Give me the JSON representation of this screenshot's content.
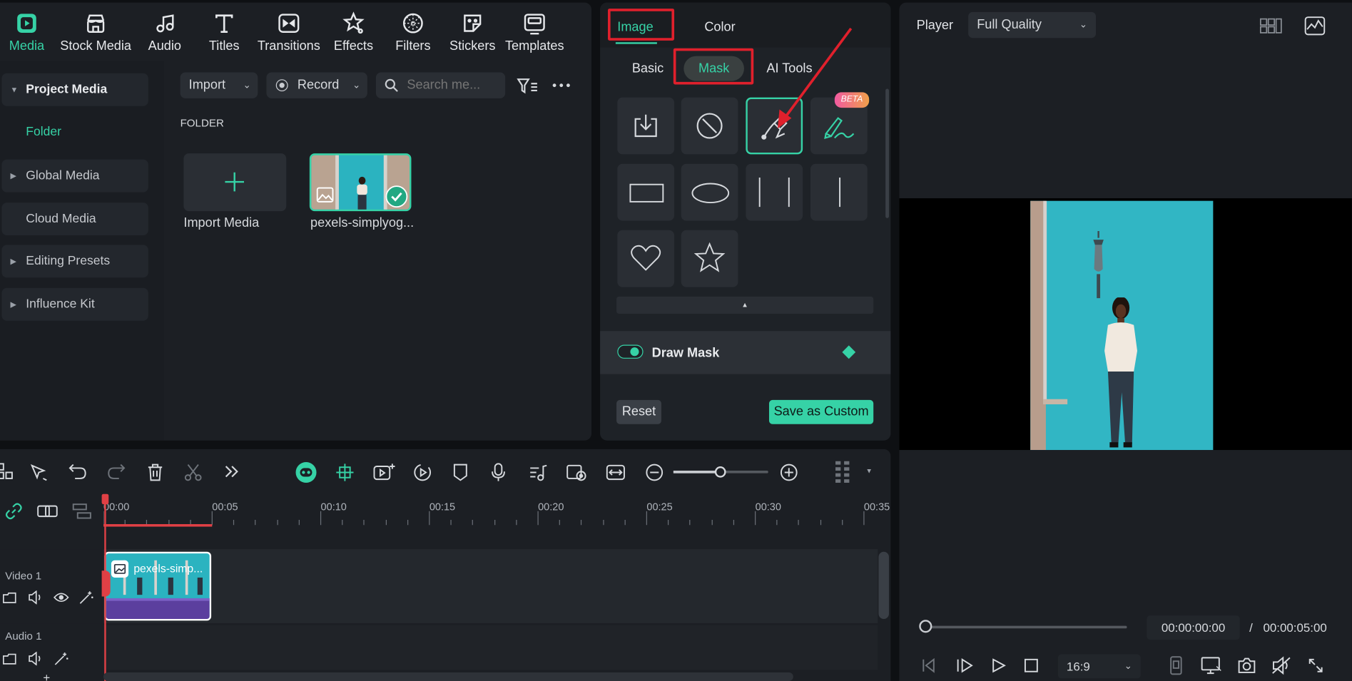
{
  "media_tabs": [
    {
      "label": "Media",
      "icon": "media-icon",
      "active": true
    },
    {
      "label": "Stock Media",
      "icon": "stock-media-icon"
    },
    {
      "label": "Audio",
      "icon": "audio-icon"
    },
    {
      "label": "Titles",
      "icon": "titles-icon"
    },
    {
      "label": "Transitions",
      "icon": "transitions-icon"
    },
    {
      "label": "Effects",
      "icon": "effects-icon"
    },
    {
      "label": "Filters",
      "icon": "filters-icon"
    },
    {
      "label": "Stickers",
      "icon": "stickers-icon"
    },
    {
      "label": "Templates",
      "icon": "templates-icon"
    }
  ],
  "sidebar": {
    "project_media": "Project Media",
    "folder": "Folder",
    "global_media": "Global Media",
    "cloud_media": "Cloud Media",
    "editing_presets": "Editing Presets",
    "influence_kit": "Influence Kit"
  },
  "toolbar": {
    "import": "Import",
    "record": "Record",
    "search_placeholder": "Search me..."
  },
  "folder_heading": "FOLDER",
  "media_items": {
    "import_label": "Import Media",
    "clip_label": "pexels-simplyog..."
  },
  "properties": {
    "tabs": {
      "image": "Image",
      "color": "Color"
    },
    "subtabs": {
      "basic": "Basic",
      "mask": "Mask",
      "ai_tools": "AI Tools"
    },
    "beta_badge": "BETA",
    "draw_mask": "Draw Mask",
    "reset": "Reset",
    "save_custom": "Save as Custom"
  },
  "player": {
    "label": "Player",
    "quality": "Full Quality",
    "current_time": "00:00:00:00",
    "separator": "/",
    "total_time": "00:00:05:00",
    "aspect": "16:9"
  },
  "timeline": {
    "ticks": [
      "00:00",
      "00:05",
      "00:10",
      "00:15",
      "00:20",
      "00:25",
      "00:30",
      "00:35"
    ],
    "video_track": "Video 1",
    "audio_track": "Audio 1",
    "clip_title": "pexels-simp..."
  },
  "colors": {
    "accent": "#36d2a6",
    "highlight": "#e0202c",
    "clip_bg": "#2bb3c0",
    "clip_audio": "#5b3f9e"
  }
}
